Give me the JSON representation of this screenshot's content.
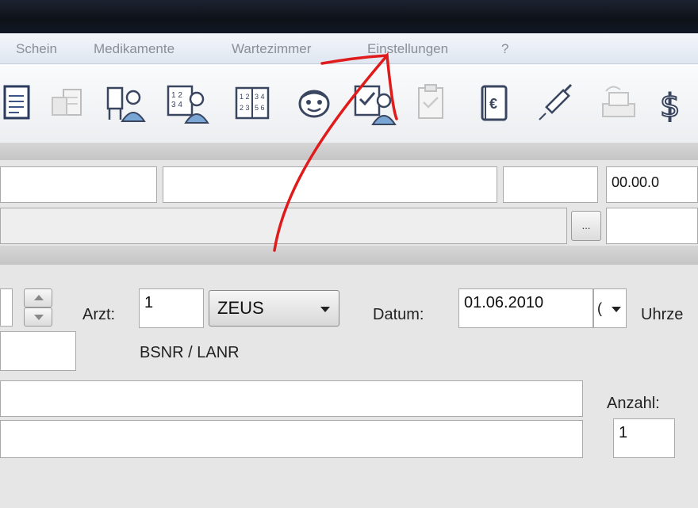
{
  "menu": {
    "items": [
      {
        "label": "Schein"
      },
      {
        "label": "Medikamente"
      },
      {
        "label": "Wartezimmer"
      },
      {
        "label": "Einstellungen"
      },
      {
        "label": "?"
      }
    ]
  },
  "toolbar": {
    "icons": [
      "document-icon",
      "print-preview-icon",
      "patient-chair-icon",
      "patient-card-icon",
      "number-list-icon",
      "face-icon",
      "checklist-patient-icon",
      "clipboard-icon",
      "euro-book-icon",
      "syringe-icon",
      "printer-icon",
      "dollar-icon"
    ]
  },
  "header_fields": {
    "date_value": "00.00.0",
    "browse_label": "..."
  },
  "form": {
    "arzt_label": "Arzt:",
    "arzt_value": "1",
    "doctor_select": "ZEUS",
    "datum_label": "Datum:",
    "datum_value": "01.06.2010",
    "datum_partial": "(",
    "uhrzeit_label": "Uhrze",
    "bsnr_label": "BSNR / LANR",
    "anzahl_label": "Anzahl:",
    "anzahl_value": "1"
  },
  "colors": {
    "annotation": "#e01b1b"
  }
}
